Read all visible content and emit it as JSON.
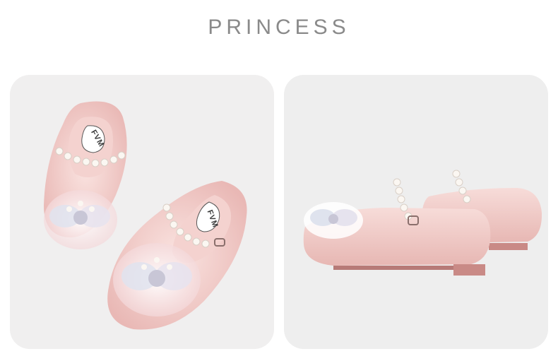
{
  "heading": {
    "text": "PRINCESS",
    "color": "#8a8a8a"
  },
  "images": [
    {
      "name": "top-view-pair",
      "background": "#f0efef",
      "brand_text": "FVM"
    },
    {
      "name": "side-view-pair",
      "background": "#eeeeee"
    }
  ],
  "colors": {
    "shoe_pink": "#f1c9c7",
    "glitter": "#f7dcd9",
    "sole": "#c98a86",
    "pearl": "#fbf7f2"
  }
}
